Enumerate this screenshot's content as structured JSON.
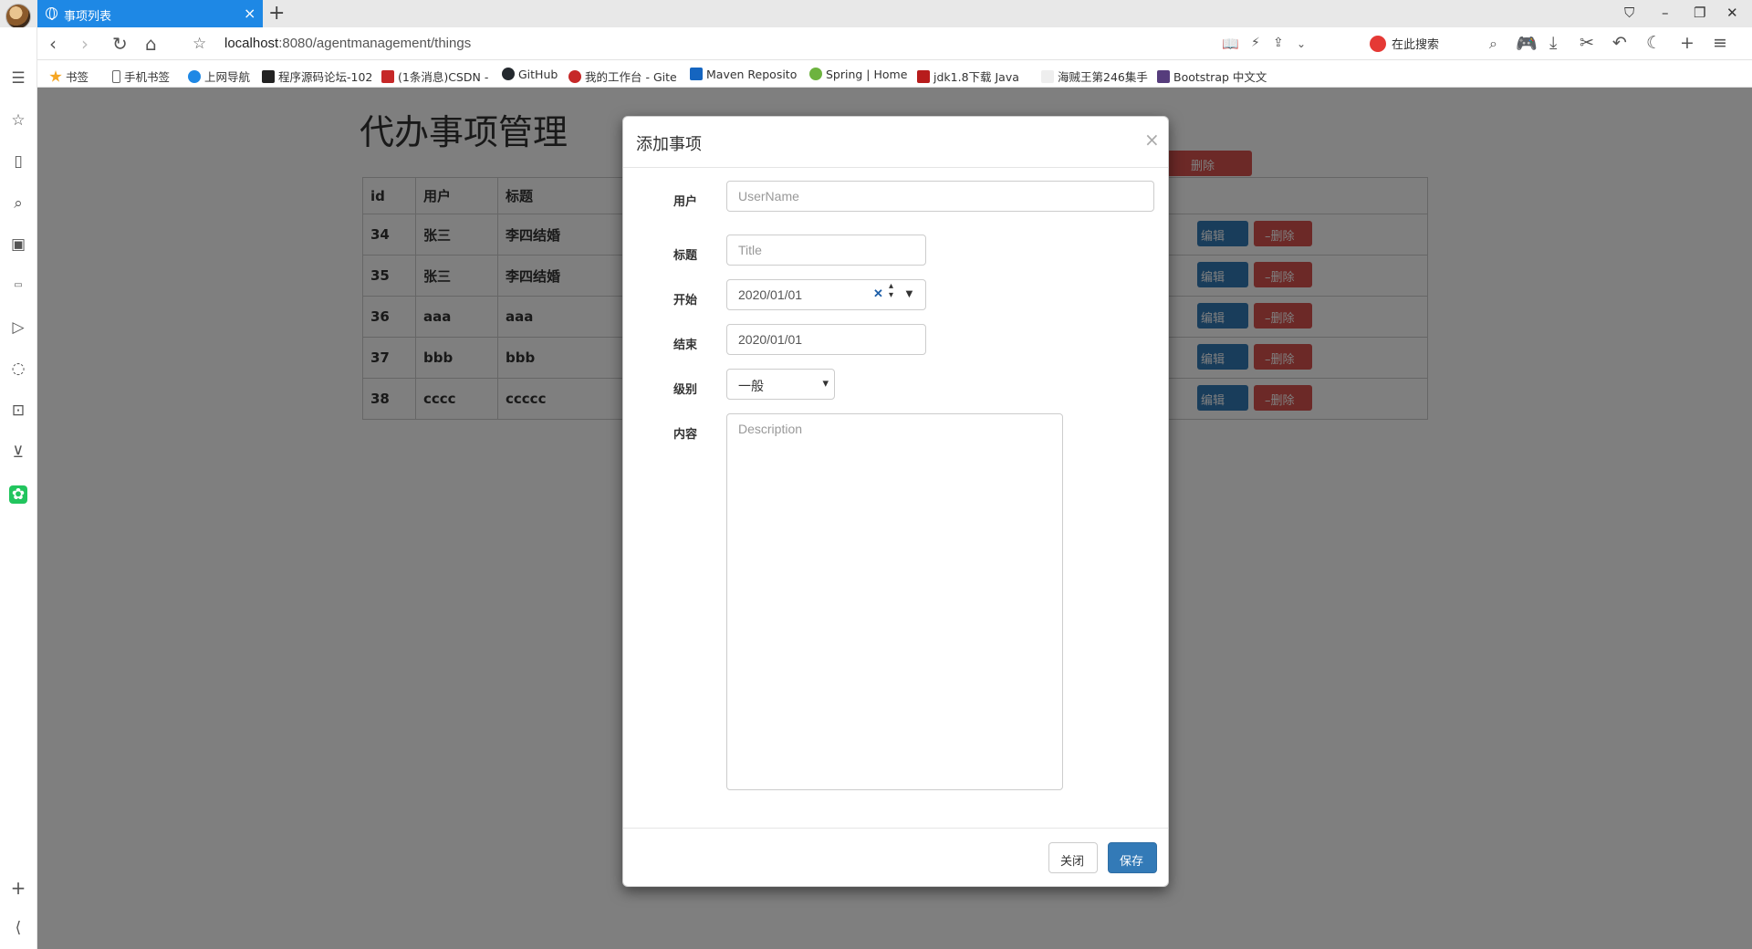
{
  "browser": {
    "tab_title": "事项列表",
    "tab_close": "×",
    "new_tab": "+",
    "url_host": "localhost",
    "url_rest": ":8080/agentmanagement/things",
    "search_placeholder": "在此搜索",
    "window_controls": [
      "⛉",
      "–",
      "❐",
      "✕"
    ]
  },
  "bookmarks": [
    {
      "label": "书签",
      "color": "#f5a623"
    },
    {
      "label": "手机书签",
      "color": "#666666"
    },
    {
      "label": "上网导航",
      "color": "#1e88e5"
    },
    {
      "label": "程序源码论坛-102",
      "color": "#222222"
    },
    {
      "label": "(1条消息)CSDN -",
      "color": "#c62828"
    },
    {
      "label": "GitHub",
      "color": "#24292e"
    },
    {
      "label": "我的工作台 - Gite",
      "color": "#c62828"
    },
    {
      "label": "Maven Reposito",
      "color": "#1565c0"
    },
    {
      "label": "Spring | Home",
      "color": "#6db33f"
    },
    {
      "label": "jdk1.8下载 Java",
      "color": "#b71c1c"
    },
    {
      "label": "海贼王第246集手",
      "color": "#999999"
    },
    {
      "label": "Bootstrap 中文文",
      "color": "#563d7c"
    }
  ],
  "page": {
    "title": "代办事项管理",
    "top_delete_label": "删除",
    "columns": [
      "id",
      "用户",
      "标题"
    ],
    "rows": [
      {
        "id": "34",
        "user": "张三",
        "title": "李四结婚"
      },
      {
        "id": "35",
        "user": "张三",
        "title": "李四结婚"
      },
      {
        "id": "36",
        "user": "aaa",
        "title": "aaa"
      },
      {
        "id": "37",
        "user": "bbb",
        "title": "bbb"
      },
      {
        "id": "38",
        "user": "cccc",
        "title": "ccccc"
      }
    ],
    "edit_label": "编辑",
    "delete_label": "–删除"
  },
  "modal": {
    "title": "添加事项",
    "close_x": "×",
    "fields": {
      "user_label": "用户",
      "user_placeholder": "UserName",
      "title_label": "标题",
      "title_placeholder": "Title",
      "start_label": "开始",
      "start_value": "2020/01/01",
      "end_label": "结束",
      "end_value": "2020/01/01",
      "level_label": "级别",
      "level_value": "一般",
      "content_label": "内容",
      "content_placeholder": "Description"
    },
    "close_button": "关闭",
    "save_button": "保存"
  },
  "colors": {
    "tab_active": "#1e88e5",
    "primary": "#337ab7",
    "danger": "#d9534f",
    "overlay": "rgba(0,0,0,0.5)"
  }
}
